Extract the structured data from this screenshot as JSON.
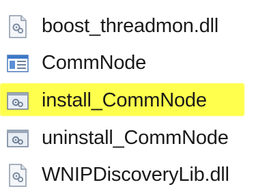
{
  "files": [
    {
      "name": "boost_threadmon.dll",
      "icon": "dll-file-icon",
      "highlighted": false
    },
    {
      "name": "CommNode",
      "icon": "application-window-icon",
      "highlighted": false
    },
    {
      "name": "install_CommNode",
      "icon": "batch-file-icon",
      "highlighted": true,
      "highlight_color": "#ffff4d"
    },
    {
      "name": "uninstall_CommNode",
      "icon": "batch-file-icon",
      "highlighted": false
    },
    {
      "name": "WNIPDiscoveryLib.dll",
      "icon": "dll-file-icon",
      "highlighted": false
    }
  ]
}
